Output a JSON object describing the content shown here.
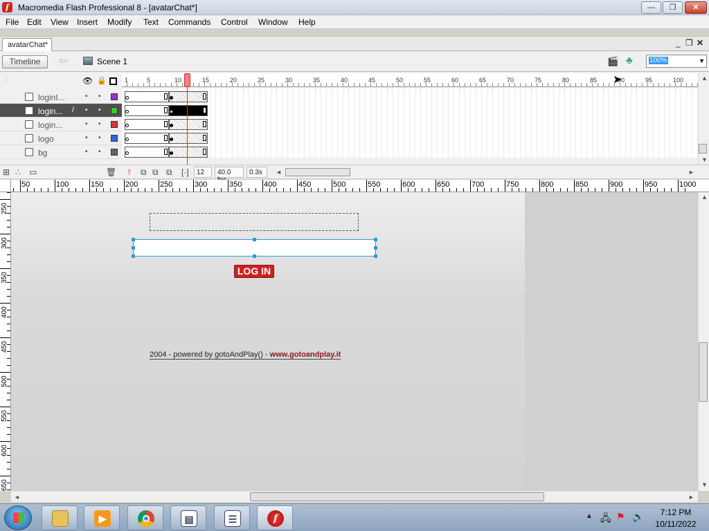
{
  "window": {
    "title": "Macromedia Flash Professional 8 - [avatarChat*]",
    "app_icon_glyph": "f",
    "minimize_glyph": "—",
    "maximize_glyph": "❐",
    "close_glyph": "✕"
  },
  "menu": [
    "File",
    "Edit",
    "View",
    "Insert",
    "Modify",
    "Text",
    "Commands",
    "Control",
    "Window",
    "Help"
  ],
  "doc": {
    "tab_label": "avatarChat*",
    "minimize_glyph": "_",
    "restore_glyph": "❐",
    "close_glyph": "✕"
  },
  "editbar": {
    "timeline_label": "Timeline",
    "back_glyph": "⇦",
    "scene_label": "Scene 1",
    "zoom_value": "100%",
    "zoom_arrow": "▼"
  },
  "timeline": {
    "eye_glyph": "👁",
    "lock_glyph": "🔒",
    "frame_numbers": [
      "1",
      "5",
      "10",
      "15",
      "20",
      "25",
      "30",
      "35",
      "40",
      "45",
      "50",
      "55",
      "60",
      "65",
      "70",
      "75",
      "80",
      "85",
      "90",
      "95",
      "100"
    ],
    "layers": [
      {
        "name": "loginI...",
        "color": "#9933cc",
        "selected": false
      },
      {
        "name": "login...",
        "color": "#33cc33",
        "selected": true
      },
      {
        "name": "login...",
        "color": "#dd3333",
        "selected": false
      },
      {
        "name": "logo",
        "color": "#3366dd",
        "selected": false
      },
      {
        "name": "bg",
        "color": "#666666",
        "selected": false
      }
    ],
    "current_frame": "12",
    "fps": "40.0 fps",
    "elapsed": "0.3s",
    "dot_glyph": "•",
    "pencil_glyph": "/"
  },
  "stage": {
    "hruler_labels": [
      "50",
      "100",
      "150",
      "200",
      "250",
      "300",
      "350",
      "400",
      "450",
      "500",
      "550",
      "600",
      "650",
      "700",
      "750",
      "800",
      "850",
      "900",
      "950",
      "1000"
    ],
    "vruler_labels": [
      "250",
      "300",
      "350",
      "400",
      "450",
      "500",
      "550",
      "600",
      "650"
    ],
    "login_button_label": "LOG IN",
    "footer_text": "2004 - powered by gotoAndPlay()  - ",
    "footer_link": "www.gotoandplay.it"
  },
  "taskbar": {
    "clock_time": "7:12 PM",
    "clock_date": "10/11/2022",
    "tray_up_glyph": "▲",
    "apps": [
      "file-explorer",
      "media-player",
      "chrome",
      "presentation",
      "list-app",
      "flash"
    ]
  }
}
